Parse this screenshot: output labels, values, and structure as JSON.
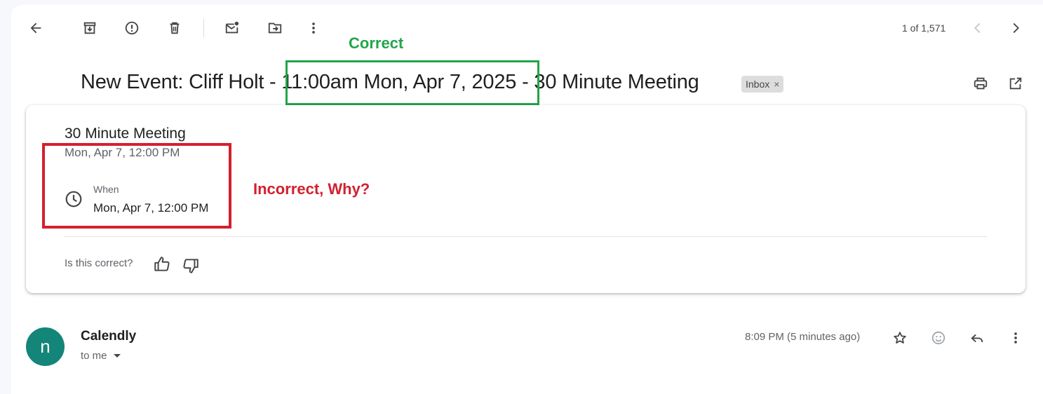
{
  "toolbar": {
    "back": "arrow-back-icon",
    "archive": "archive-icon",
    "spam": "report-spam-icon",
    "delete": "delete-icon",
    "unread": "mark-unread-icon",
    "move": "move-to-icon",
    "more": "more-vert-icon"
  },
  "pager": {
    "text": "1 of 1,571"
  },
  "subject": {
    "prefix": "New Event: Cliff Holt - ",
    "highlighted": "11:00am Mon, Apr 7, 2025",
    "suffix": " - 30 Minute Meeting"
  },
  "label_chip": {
    "text": "Inbox",
    "remove": "×"
  },
  "event_card": {
    "title": "30 Minute Meeting",
    "date": "Mon, Apr 7, 12:00 PM",
    "when_label": "When",
    "when_value": "Mon, Apr 7, 12:00 PM",
    "feedback_question": "Is this correct?"
  },
  "annotations": {
    "correct": "Correct",
    "incorrect": "Incorrect, Why?",
    "correct_color": "#22a54a",
    "incorrect_color": "#d3202f"
  },
  "message": {
    "avatar_letter": "n",
    "avatar_color": "#138579",
    "sender": "Calendly",
    "recipient": "to me",
    "time": "8:09 PM (5 minutes ago)"
  }
}
